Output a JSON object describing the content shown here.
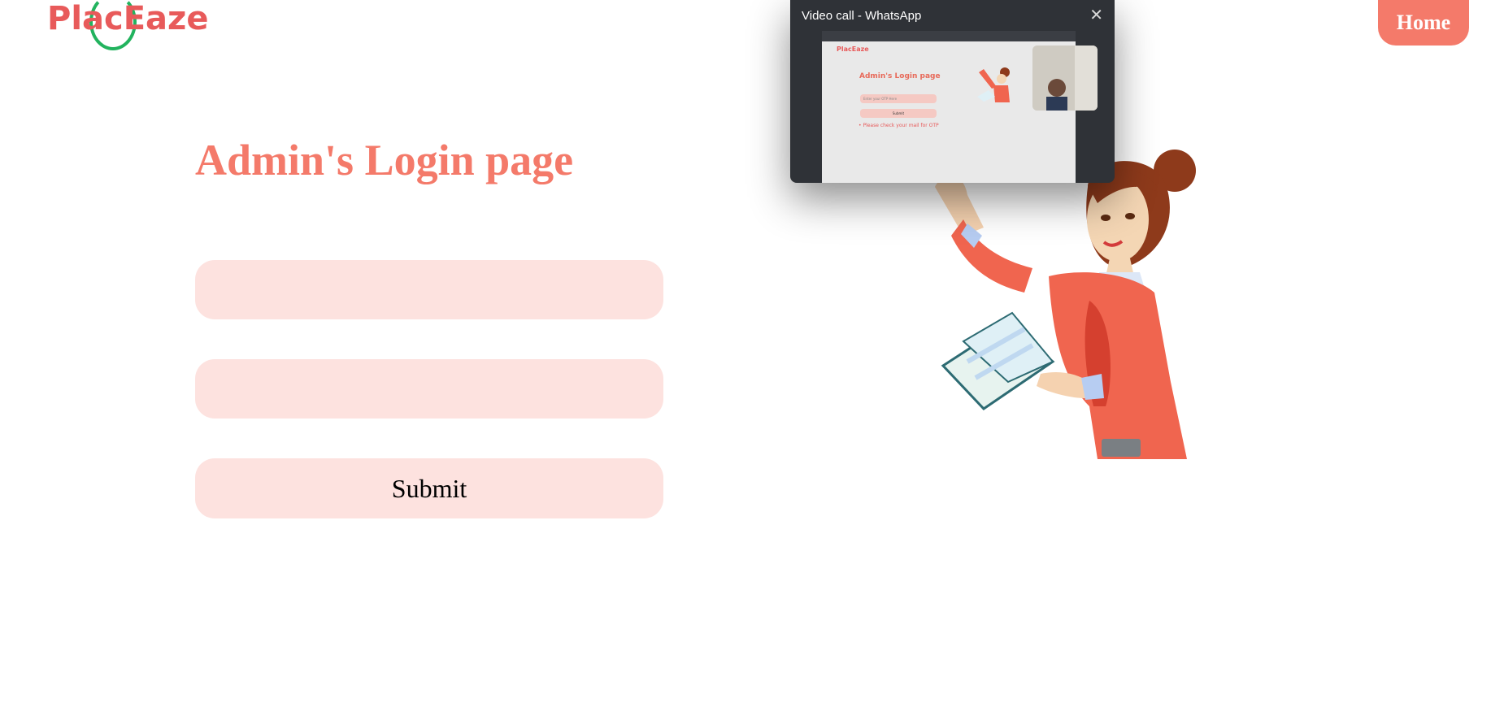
{
  "header": {
    "logo_text": "PlacEaze",
    "home_label": "Home"
  },
  "main": {
    "title": "Admin's Login page",
    "field1_value": "",
    "field2_value": "",
    "submit_label": "Submit"
  },
  "overlay": {
    "window_title": "Video call - WhatsApp",
    "close_icon": "close-icon",
    "shared_screen": {
      "logo_text": "PlacEaze",
      "title": "Admin's Login page",
      "input_placeholder": "Enter your OTP Here",
      "submit_label": "Submit",
      "note": "• Please check your mail for OTP"
    }
  },
  "colors": {
    "brand": "#f47a6a",
    "field_bg": "#fde2df",
    "logo_red": "#e85a5a",
    "logo_green": "#22b35e"
  }
}
